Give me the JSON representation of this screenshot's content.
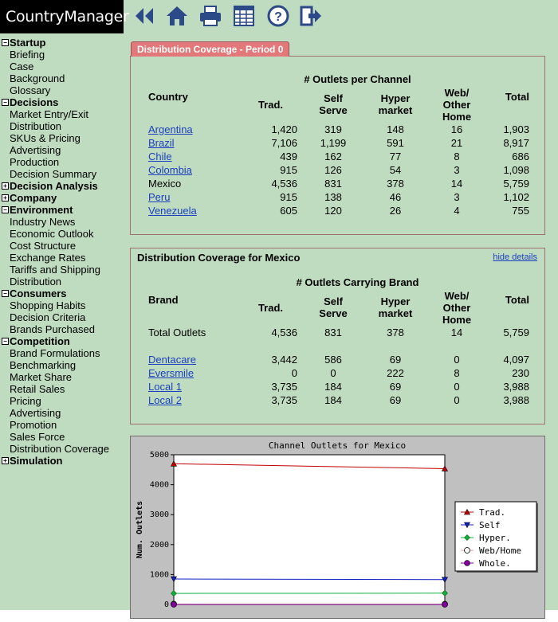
{
  "app": {
    "title": "CountryManager"
  },
  "toolbar": {
    "back": "back-icon",
    "home": "home-icon",
    "print": "print-icon",
    "spreadsheet": "spreadsheet-icon",
    "help": "help-icon",
    "exit": "exit-icon"
  },
  "sidebar": {
    "startup": {
      "label": "Startup",
      "items": [
        "Briefing",
        "Case",
        "Background",
        "Glossary"
      ]
    },
    "decisions": {
      "label": "Decisions",
      "items": [
        "Market Entry/Exit",
        "Distribution",
        "SKUs & Pricing",
        "Advertising",
        "Production",
        "Decision Summary"
      ]
    },
    "decision_analysis": {
      "label": "Decision Analysis"
    },
    "company": {
      "label": "Company"
    },
    "environment": {
      "label": "Environment",
      "items": [
        "Industry News",
        "Economic Outlook",
        "Cost Structure",
        "Exchange Rates",
        "Tariffs and Shipping",
        "Distribution"
      ]
    },
    "consumers": {
      "label": "Consumers",
      "items": [
        "Shopping Habits",
        "Decision Criteria",
        "Brands Purchased"
      ]
    },
    "competition": {
      "label": "Competition",
      "items": [
        "Brand Formulations",
        "Benchmarking",
        "Market Share",
        "Retail Sales",
        "Pricing",
        "Advertising",
        "Promotion",
        "Sales Force",
        "Distribution Coverage"
      ]
    },
    "simulation": {
      "label": "Simulation"
    }
  },
  "coverage": {
    "tab_label": "Distribution Coverage - Period 0",
    "group_header": "# Outlets per Channel",
    "col_first": "Country",
    "cols": [
      "Trad.",
      "Self",
      "Serve",
      "Hyper",
      "market",
      "Web/",
      "Other",
      "Home",
      "Total"
    ],
    "rows": [
      {
        "name": "Argentina",
        "link": true,
        "v": [
          "1,420",
          "319",
          "148",
          "16",
          "1,903"
        ]
      },
      {
        "name": "Brazil",
        "link": true,
        "v": [
          "7,106",
          "1,199",
          "591",
          "21",
          "8,917"
        ]
      },
      {
        "name": "Chile",
        "link": true,
        "v": [
          "439",
          "162",
          "77",
          "8",
          "686"
        ]
      },
      {
        "name": "Colombia",
        "link": true,
        "v": [
          "915",
          "126",
          "54",
          "3",
          "1,098"
        ]
      },
      {
        "name": "Mexico",
        "link": false,
        "v": [
          "4,536",
          "831",
          "378",
          "14",
          "5,759"
        ]
      },
      {
        "name": "Peru",
        "link": true,
        "v": [
          "915",
          "138",
          "46",
          "3",
          "1,102"
        ]
      },
      {
        "name": "Venezuela",
        "link": true,
        "v": [
          "605",
          "120",
          "26",
          "4",
          "755"
        ]
      }
    ]
  },
  "mexico": {
    "title": "Distribution Coverage for Mexico",
    "hide_link": "hide details",
    "group_header": "# Outlets Carrying Brand",
    "col_first": "Brand",
    "total_row": {
      "name": "Total Outlets",
      "v": [
        "4,536",
        "831",
        "378",
        "14",
        "5,759"
      ]
    },
    "rows": [
      {
        "name": "Dentacare",
        "v": [
          "3,442",
          "586",
          "69",
          "0",
          "4,097"
        ]
      },
      {
        "name": "Eversmile",
        "v": [
          "0",
          "0",
          "222",
          "8",
          "230"
        ]
      },
      {
        "name": "Local 1",
        "v": [
          "3,735",
          "184",
          "69",
          "0",
          "3,988"
        ]
      },
      {
        "name": "Local 2",
        "v": [
          "3,735",
          "184",
          "69",
          "0",
          "3,988"
        ]
      }
    ]
  },
  "chart_data": {
    "type": "line",
    "title": "Channel Outlets for Mexico",
    "ylabel": "Num. Outlets",
    "xlabel": "",
    "ylim": [
      0,
      5000
    ],
    "yticks": [
      "5000",
      "4000",
      "3000",
      "2000",
      "1000",
      "0"
    ],
    "x": [
      0,
      1
    ],
    "legend_position": "right",
    "series": [
      {
        "name": "Trad.",
        "values": [
          4700,
          4536
        ],
        "color": "#c00000",
        "marker": "triangle-up"
      },
      {
        "name": "Self",
        "values": [
          850,
          831
        ],
        "color": "#1020c0",
        "marker": "triangle-down"
      },
      {
        "name": "Hyper.",
        "values": [
          370,
          378
        ],
        "color": "#10b040",
        "marker": "diamond"
      },
      {
        "name": "Web/Home",
        "values": [
          15,
          14
        ],
        "color": "#e0a0a0",
        "marker": "circle"
      },
      {
        "name": "Whole.",
        "values": [
          0,
          0
        ],
        "color": "#8000a0",
        "marker": "filled-circle"
      }
    ]
  }
}
